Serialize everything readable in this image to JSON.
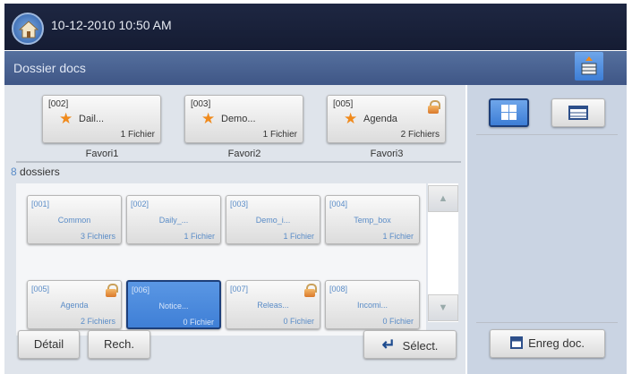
{
  "header": {
    "datetime": "10-12-2010 10:50 AM"
  },
  "titlebar": {
    "title": "Dossier docs"
  },
  "favorites": [
    {
      "id": "[002]",
      "name": "Dail...",
      "count": "1 Fichier",
      "label": "Favori1",
      "locked": false
    },
    {
      "id": "[003]",
      "name": "Demo...",
      "count": "1 Fichier",
      "label": "Favori2",
      "locked": false
    },
    {
      "id": "[005]",
      "name": "Agenda",
      "count": "2 Fichiers",
      "label": "Favori3",
      "locked": true
    }
  ],
  "folder_count": {
    "number": "8",
    "label": " dossiers"
  },
  "folders": [
    {
      "id": "[001]",
      "name": "Common",
      "count": "3 Fichiers"
    },
    {
      "id": "[002]",
      "name": "Daily_...",
      "count": "1 Fichier"
    },
    {
      "id": "[003]",
      "name": "Demo_i...",
      "count": "1 Fichier"
    },
    {
      "id": "[004]",
      "name": "Temp_box",
      "count": "1 Fichier"
    },
    {
      "id": "[005]",
      "name": "Agenda",
      "count": "2 Fichiers"
    },
    {
      "id": "[006]",
      "name": "Notice...",
      "count": "0 Fichier"
    },
    {
      "id": "[007]",
      "name": "Releas...",
      "count": "0 Fichier"
    },
    {
      "id": "[008]",
      "name": "Incomi...",
      "count": "0 Fichier"
    }
  ],
  "buttons": {
    "detail": "Détail",
    "search": "Rech.",
    "select": "Sélect.",
    "save": "Enreg doc."
  },
  "colors": {
    "accent": "#3f7fd6",
    "header": "#1e2742",
    "titlebar": "#4a6392"
  }
}
